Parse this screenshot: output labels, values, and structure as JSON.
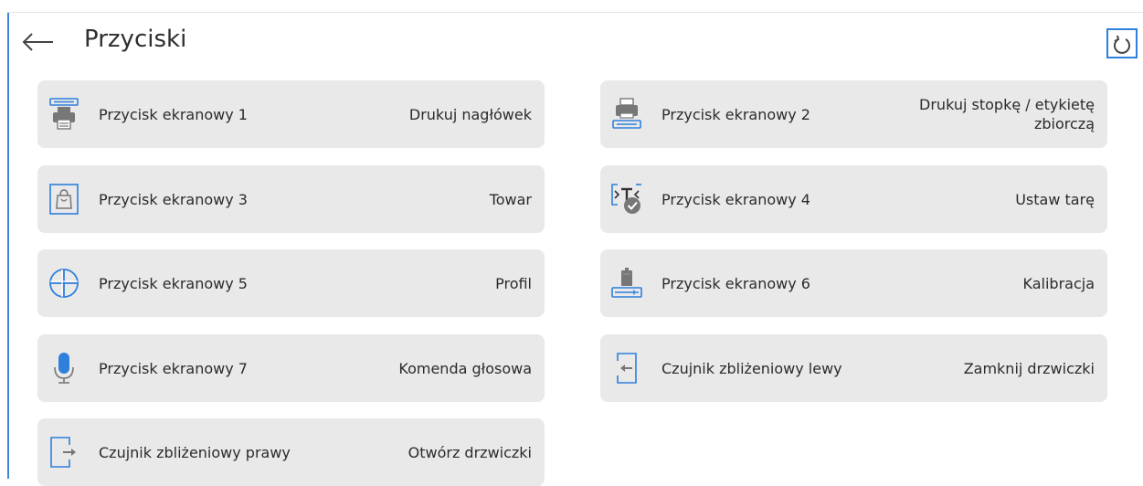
{
  "header": {
    "title": "Przyciski"
  },
  "icons": {
    "back": "arrow-left-icon",
    "reset": "refresh-icon"
  },
  "colors": {
    "accent": "#2f7fdc",
    "tile_bg": "#e9e9e9",
    "icon_gray": "#777777"
  },
  "tiles": [
    {
      "name": "Przycisk ekranowy 1",
      "value": "Drukuj nagłówek",
      "icon": "print-header-icon"
    },
    {
      "name": "Przycisk ekranowy 2",
      "value": "Drukuj stopkę / etykietę zbiorczą",
      "icon": "print-footer-icon"
    },
    {
      "name": "Przycisk ekranowy 3",
      "value": "Towar",
      "icon": "product-bag-icon"
    },
    {
      "name": "Przycisk ekranowy 4",
      "value": "Ustaw tarę",
      "icon": "tare-icon"
    },
    {
      "name": "Przycisk ekranowy 5",
      "value": "Profil",
      "icon": "profile-icon"
    },
    {
      "name": "Przycisk ekranowy 6",
      "value": "Kalibracja",
      "icon": "calibration-weight-icon"
    },
    {
      "name": "Przycisk ekranowy 7",
      "value": "Komenda głosowa",
      "icon": "microphone-icon"
    },
    {
      "name": "Czujnik zbliżeniowy lewy",
      "value": "Zamknij drzwiczki",
      "icon": "close-door-icon"
    },
    {
      "name": "Czujnik zbliżeniowy prawy",
      "value": "Otwórz drzwiczki",
      "icon": "open-door-icon"
    }
  ]
}
